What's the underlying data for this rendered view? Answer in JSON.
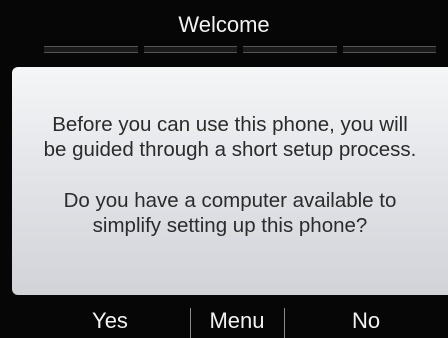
{
  "header": {
    "title": "Welcome"
  },
  "dialog": {
    "paragraph_1_line_1": "Before you can use this phone, you will",
    "paragraph_1_line_2": "be guided through a short setup process.",
    "paragraph_2_line_1": "Do you have a computer available to",
    "paragraph_2_line_2": "simplify setting up this phone?"
  },
  "softkeys": {
    "left_label": "Yes",
    "middle_label": "Menu",
    "right_label": "No"
  },
  "colors": {
    "background": "#060606",
    "dialog_top": "#f5f6f7",
    "dialog_bottom": "#d1d3d8",
    "text_light": "#f2f2f2",
    "text_dark": "#2b2b2b"
  }
}
